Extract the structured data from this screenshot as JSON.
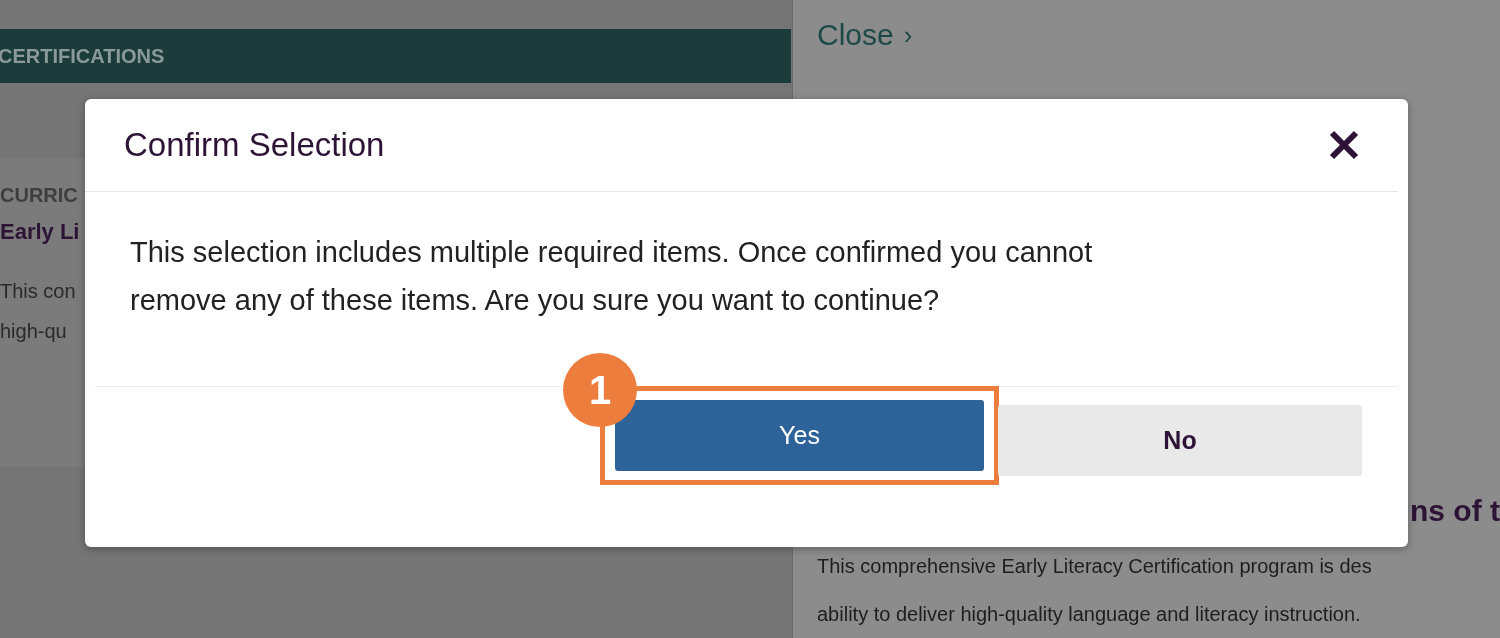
{
  "background": {
    "header": "CERTIFICATIONS",
    "card": {
      "label": "CURRIC",
      "title": "Early Li",
      "description": [
        "This con",
        "high-qu"
      ]
    },
    "close_link": {
      "label": "Close",
      "chevron": "›"
    },
    "heading": "ns of t",
    "paragraph": [
      "This comprehensive Early Literacy Certification program is des",
      "ability to deliver high-quality language and literacy instruction."
    ]
  },
  "dialog": {
    "title": "Confirm Selection",
    "message": "This selection includes multiple required items. Once confirmed you cannot remove any of these items. Are you sure you want to continue?",
    "buttons": [
      {
        "label": "Yes",
        "kind": "primary",
        "highlighted": true,
        "callout": "1"
      },
      {
        "label": "No",
        "kind": "secondary",
        "highlighted": false
      }
    ]
  }
}
